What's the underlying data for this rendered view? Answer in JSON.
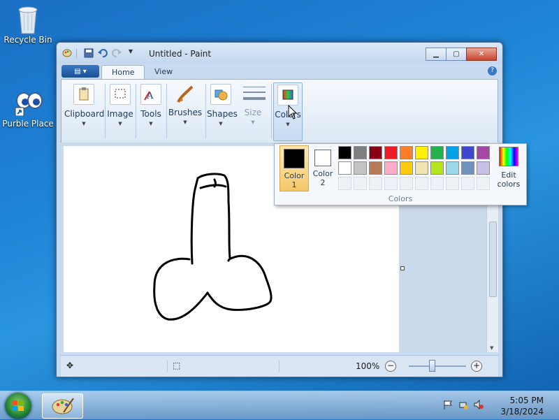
{
  "desktop": {
    "icons": [
      {
        "label": "Recycle Bin",
        "icon": "recycle-bin-icon"
      },
      {
        "label": "Purble Place",
        "icon": "purble-place-icon"
      }
    ]
  },
  "window": {
    "title": "Untitled - Paint",
    "tabs": [
      {
        "label": "Home",
        "active": true
      },
      {
        "label": "View",
        "active": false
      }
    ],
    "groups": [
      {
        "label": "Clipboard"
      },
      {
        "label": "Image"
      },
      {
        "label": "Tools"
      },
      {
        "label": "Brushes"
      },
      {
        "label": "Shapes"
      },
      {
        "label": "Size"
      },
      {
        "label": "Colors"
      }
    ]
  },
  "colors_popup": {
    "color1_label": "Color\n1",
    "color1_a": "Color",
    "color1_b": "1",
    "color2_a": "Color",
    "color2_b": "2",
    "color1": "#000000",
    "color2": "#ffffff",
    "palette": [
      "#000000",
      "#7f7f7f",
      "#880015",
      "#ed1c24",
      "#ff7f27",
      "#fff200",
      "#22b14c",
      "#00a2e8",
      "#3f48cc",
      "#a349a4",
      "#ffffff",
      "#c3c3c3",
      "#b97a57",
      "#ffaec9",
      "#ffc90e",
      "#efe4b0",
      "#b5e61d",
      "#99d9ea",
      "#7092be",
      "#c8bfe7"
    ],
    "edit_colors_a": "Edit",
    "edit_colors_b": "colors",
    "group_label": "Colors"
  },
  "status": {
    "zoom": "100%"
  },
  "taskbar": {
    "time": "5:05 PM",
    "date": "3/18/2024"
  }
}
